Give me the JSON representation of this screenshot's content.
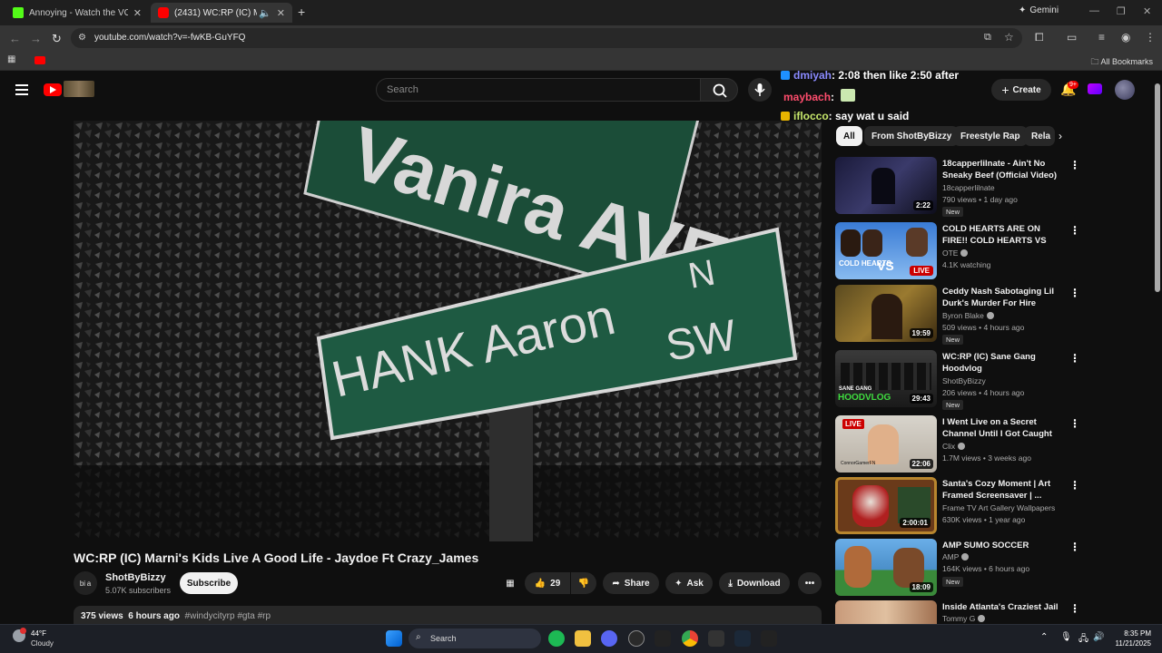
{
  "browser": {
    "tabs": [
      {
        "title": "Annoying - Watch the VOD on",
        "favicon_color": "#53fc18"
      },
      {
        "title": "(2431) WC:RP (IC) Marni's K",
        "favicon_color": "#ff0000"
      }
    ],
    "new_tab_icon": "plus-icon",
    "gemini_label": "Gemini",
    "url": "youtube.com/watch?v=-fwKB-GuYFQ",
    "all_bookmarks_label": "All Bookmarks"
  },
  "youtube": {
    "search_placeholder": "Search",
    "create_label": "Create",
    "notification_count": "9+",
    "video": {
      "title": "WC:RP (IC) Marni's Kids Live A Good Life - Jaydoe Ft Crazy_James",
      "sign_upper_text": "Vanira AVE",
      "sign_lower_text": "HANK Aaron",
      "sign_direction_n": "N",
      "sign_direction_sw": "SW"
    },
    "channel": {
      "name": "ShotByBizzy",
      "subscribers": "5.07K subscribers",
      "avatar_text": "bi a"
    },
    "subscribe_label": "Subscribe",
    "likes": "29",
    "share_label": "Share",
    "ask_label": "Ask",
    "download_label": "Download",
    "description": {
      "views": "375 views",
      "age": "6 hours ago",
      "hashtags": "#windycityrp #gta #rp"
    },
    "chat": [
      {
        "user": "dmiyah",
        "message": ": 2:08 then like 2:50 after",
        "user_color": "#8a8aff",
        "badge_color": "#1e90ff"
      },
      {
        "user": "maybach",
        "message": ":",
        "user_color": "#ff4d6d",
        "badge_color": ""
      },
      {
        "user": "iflocco",
        "message": ": say wat u said",
        "user_color": "#c6e76b",
        "badge_color": "#e8b400"
      }
    ],
    "chips": [
      "All",
      "From ShotByBizzy",
      "Freestyle Rap",
      "Rela"
    ],
    "recommendations": [
      {
        "title": "18capperlilnate - Ain't No Sneaky Beef (Official Video)",
        "channel": "18capperlilnate",
        "meta": "790 views • 1 day ago",
        "badge": "New",
        "duration": "2:22",
        "verified": false
      },
      {
        "title": "COLD HEARTS ARE ON FIRE!! COLD HEARTS VS BLUE ...",
        "channel": "OTE",
        "meta": "4.1K watching",
        "badge": "",
        "duration": "LIVE",
        "verified": true
      },
      {
        "title": "Ceddy Nash Sabotaging Lil Durk's Murder For Hire Case?! ...",
        "channel": "Byron Blake",
        "meta": "509 views • 4 hours ago",
        "badge": "New",
        "duration": "19:59",
        "verified": true
      },
      {
        "title": "WC:RP (IC) Sane Gang Hoodvlog",
        "channel": "ShotByBizzy",
        "meta": "206 views • 4 hours ago",
        "badge": "New",
        "duration": "29:43",
        "verified": false
      },
      {
        "title": "I Went Live on a Secret Channel Until I Got Caught",
        "channel": "Clix",
        "meta": "1.7M views • 3 weeks ago",
        "badge": "",
        "duration": "22:06",
        "verified": true
      },
      {
        "title": "Santa's Cozy Moment | Art Framed Screensaver | ...",
        "channel": "Frame TV Art Gallery Wallpapers",
        "meta": "630K views • 1 year ago",
        "badge": "",
        "duration": "2:00:01",
        "verified": false
      },
      {
        "title": "AMP SUMO SOCCER",
        "channel": "AMP",
        "meta": "164K views • 6 hours ago",
        "badge": "New",
        "duration": "18:09",
        "verified": true
      },
      {
        "title": "Inside Atlanta's Craziest Jail",
        "channel": "Tommy G",
        "meta": "",
        "badge": "",
        "duration": "",
        "verified": true
      }
    ]
  },
  "thumb_labels": {
    "cold_hearts": "COLD HEARTS",
    "vs": "VS",
    "live": "LIVE",
    "sane_gang": "SANE GANG",
    "hoodvlog": "HOODVLOG",
    "clix_live": "LIVE",
    "clix_handle": "ConnorGamerFN"
  },
  "taskbar": {
    "temperature": "44°F",
    "weather": "Cloudy",
    "search_label": "Search",
    "time": "8:35 PM",
    "date": "11/21/2025"
  }
}
